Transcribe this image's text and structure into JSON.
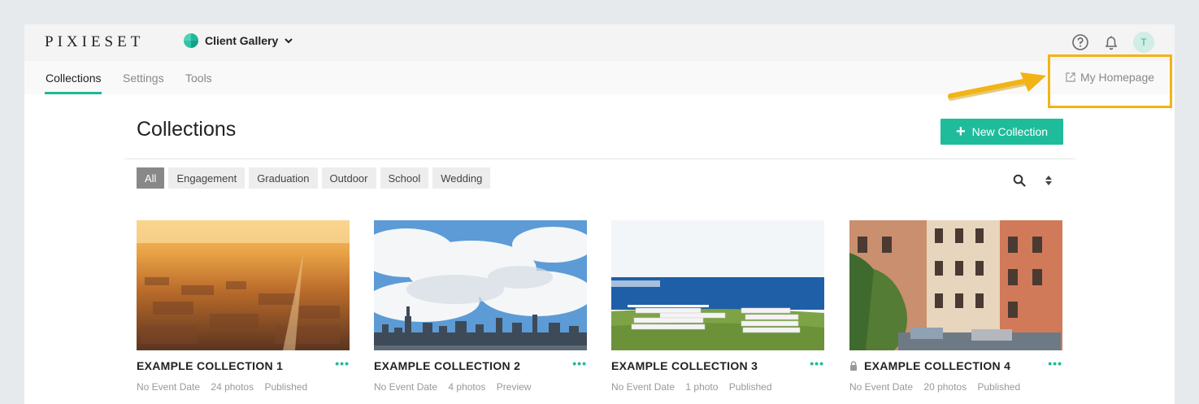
{
  "brand": {
    "logo": "PIXIESET"
  },
  "header": {
    "gallery_label": "Client Gallery",
    "avatar_initial": "T"
  },
  "tabs": [
    {
      "label": "Collections",
      "active": true
    },
    {
      "label": "Settings",
      "active": false
    },
    {
      "label": "Tools",
      "active": false
    }
  ],
  "homepage_link": "My Homepage",
  "page": {
    "title": "Collections",
    "new_button": "New Collection"
  },
  "filters": [
    "All",
    "Engagement",
    "Graduation",
    "Outdoor",
    "School",
    "Wedding"
  ],
  "collections": [
    {
      "title": "EXAMPLE COLLECTION 1",
      "date": "No Event Date",
      "count": "24 photos",
      "status": "Published",
      "locked": false
    },
    {
      "title": "EXAMPLE COLLECTION 2",
      "date": "No Event Date",
      "count": "4 photos",
      "status": "Preview",
      "locked": false
    },
    {
      "title": "EXAMPLE COLLECTION 3",
      "date": "No Event Date",
      "count": "1 photo",
      "status": "Published",
      "locked": false
    },
    {
      "title": "EXAMPLE COLLECTION 4",
      "date": "No Event Date",
      "count": "20 photos",
      "status": "Published",
      "locked": true
    }
  ],
  "colors": {
    "accent": "#1fbc9c",
    "highlight": "#f2b415"
  },
  "icons": [
    "gallery-icon",
    "chevron-down-icon",
    "help-icon",
    "bell-icon",
    "external-link-icon",
    "plus-icon",
    "search-icon",
    "sort-icon",
    "lock-icon",
    "more-icon"
  ]
}
